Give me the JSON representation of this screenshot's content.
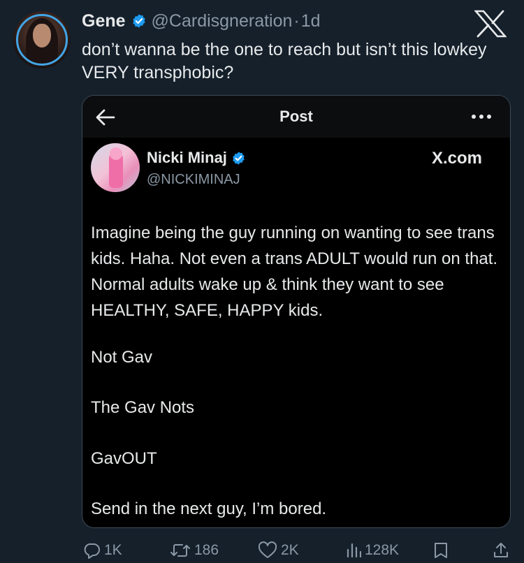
{
  "tweet": {
    "author_name": "Gene",
    "handle": "@Cardisgneration",
    "separator": "·",
    "time": "1d",
    "text": "don’t wanna be the one to reach but isn’t this lowkey VERY transphobic?"
  },
  "quoted_card": {
    "header_title": "Post",
    "author_name": "Nicki Minaj",
    "handle": "@NICKIMINAJ",
    "source_label": "X.com",
    "paragraphs": [
      "Imagine being the guy running on wanting to see trans kids. Haha. Not even a trans ADULT would run on that. Normal adults wake up & think they want to see HEALTHY, SAFE, HAPPY kids.",
      "Not Gav",
      "The Gav Nots",
      "GavOUT",
      "Send in the next guy, I’m bored."
    ]
  },
  "actions": {
    "replies": "1K",
    "reposts": "186",
    "likes": "2K",
    "views": "128K"
  },
  "colors": {
    "background": "#15202b",
    "verified": "#1d9bf0",
    "muted_text": "#8b98a5",
    "card_background": "#000000"
  },
  "icons": [
    "verified-badge-icon",
    "x-logo-icon",
    "back-arrow-icon",
    "more-dots-icon",
    "reply-icon",
    "repost-icon",
    "like-icon",
    "views-icon",
    "bookmark-icon",
    "share-icon"
  ]
}
